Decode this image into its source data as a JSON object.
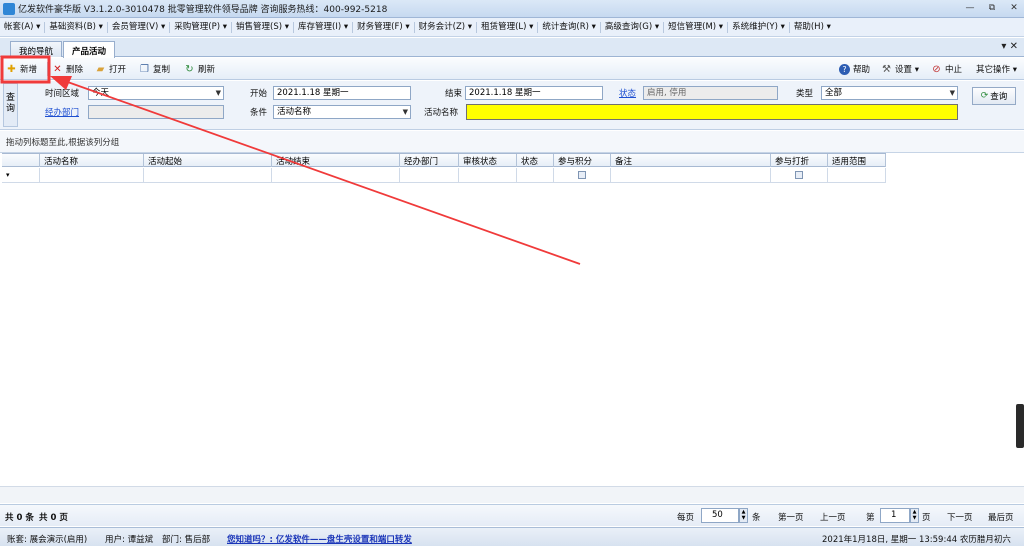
{
  "window": {
    "title": "亿发软件豪华版 V3.1.2.0-3010478 批零管理软件领导品牌 咨询服务热线：400-992-5218",
    "controls": [
      "—",
      "⧉",
      "✕"
    ]
  },
  "menu": [
    "帐套(A) ▾",
    "基础资料(B) ▾",
    "会员管理(V) ▾",
    "采购管理(P) ▾",
    "销售管理(S) ▾",
    "库存管理(I) ▾",
    "财务管理(F) ▾",
    "财务会计(Z) ▾",
    "租赁管理(L) ▾",
    "统计查询(R) ▾",
    "高级查询(G) ▾",
    "短信管理(M) ▾",
    "系统维护(Y) ▾",
    "帮助(H) ▾"
  ],
  "tabs": [
    {
      "label": "我的导航"
    },
    {
      "label": "产品活动"
    }
  ],
  "tab_close": "▾ ✕",
  "toolbar": {
    "add": "新增",
    "delete": "删除",
    "open": "打开",
    "copy": "复制",
    "refresh": "刷新",
    "help": "帮助",
    "settings": "设置 ▾",
    "stop": "中止",
    "other": "其它操作 ▾"
  },
  "query": {
    "side_label": "查询",
    "time_label": "时间区域",
    "time_value": "今天",
    "dept_label": "经办部门",
    "dept_value": "",
    "start_label": "开始",
    "start_value": "2021.1.18 星期一",
    "cond_label": "条件",
    "cond_value": "活动名称",
    "end_label": "结束",
    "end_value": "2021.1.18 星期一",
    "name_label": "活动名称",
    "name_value": "",
    "status_label": "状态",
    "status_value": "启用, 停用",
    "type_label": "类型",
    "type_value": "全部",
    "query_button": "查询"
  },
  "group_tip": "拖动列标题至此,根据该列分组",
  "grid": {
    "columns": [
      "活动名称",
      "活动起始",
      "活动结束",
      "经办部门",
      "审核状态",
      "状态",
      "参与积分",
      "备注",
      "参与打折",
      "适用范围"
    ],
    "new_row_marker": "▾"
  },
  "pager": {
    "total_items": "共 0 条",
    "total_pages": "共 0 页",
    "per_page_label": "每页",
    "per_page_value": "50",
    "per_page_unit": "条",
    "first": "第一页",
    "prev": "上一页",
    "page_prefix": "第",
    "page_value": "1",
    "page_suffix": "页",
    "next": "下一页",
    "last": "最后页"
  },
  "status": {
    "account": "账套: 展会演示(启用)",
    "user": "用户: 谭益斌",
    "dept": "部门: 售后部",
    "notice": "您知道吗？: 亿发软件——盘生壳设置和端口转发",
    "datetime": "2021年1月18日, 星期一 13:59:44 农历腊月初六"
  },
  "colors": {
    "annotation": "#f03a3a",
    "highlight_input": "#ffff00",
    "link": "#1e4fd1"
  }
}
